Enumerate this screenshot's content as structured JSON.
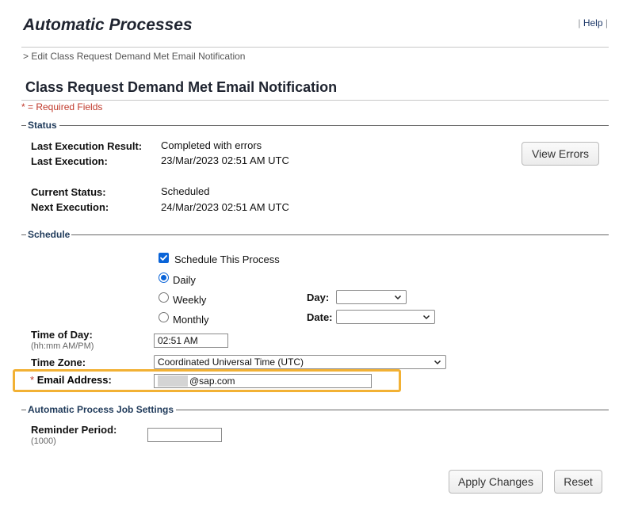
{
  "header": {
    "title": "Automatic Processes",
    "help_label": "Help",
    "pipe": "|"
  },
  "breadcrumb": "> Edit Class Request Demand Met Email Notification",
  "page_heading": "Class Request Demand Met Email Notification",
  "required_note": "* = Required Fields",
  "status": {
    "legend": "Status",
    "last_result_label": "Last Execution Result:",
    "last_result_value": "Completed with errors",
    "last_exec_label": "Last Execution:",
    "last_exec_value": "23/Mar/2023 02:51 AM UTC",
    "current_status_label": "Current Status:",
    "current_status_value": "Scheduled",
    "next_exec_label": "Next Execution:",
    "next_exec_value": "24/Mar/2023 02:51 AM UTC",
    "view_errors_label": "View Errors"
  },
  "schedule": {
    "legend": "Schedule",
    "schedule_process_label": "Schedule This Process",
    "schedule_process_checked": true,
    "frequency_options": [
      "Daily",
      "Weekly",
      "Monthly"
    ],
    "frequency_selected": "Daily",
    "day_label": "Day:",
    "day_value": "",
    "date_label": "Date:",
    "date_value": "",
    "time_of_day_label": "Time of Day:",
    "time_of_day_hint": "(hh:mm AM/PM)",
    "time_of_day_value": "02:51 AM",
    "time_zone_label": "Time Zone:",
    "time_zone_value": "Coordinated Universal Time (UTC)",
    "email_required_mark": "*",
    "email_label": "Email Address:",
    "email_value": "@sap.com"
  },
  "job_settings": {
    "legend": "Automatic Process Job Settings",
    "reminder_label": "Reminder Period:",
    "reminder_hint": "(1000)",
    "reminder_value": ""
  },
  "buttons": {
    "apply_label": "Apply Changes",
    "reset_label": "Reset"
  },
  "colors": {
    "accent_checkbox": "#0a64d8",
    "required_red": "#c0392b",
    "highlight_orange": "#f2b134",
    "legend_blue": "#1f3a5a"
  }
}
